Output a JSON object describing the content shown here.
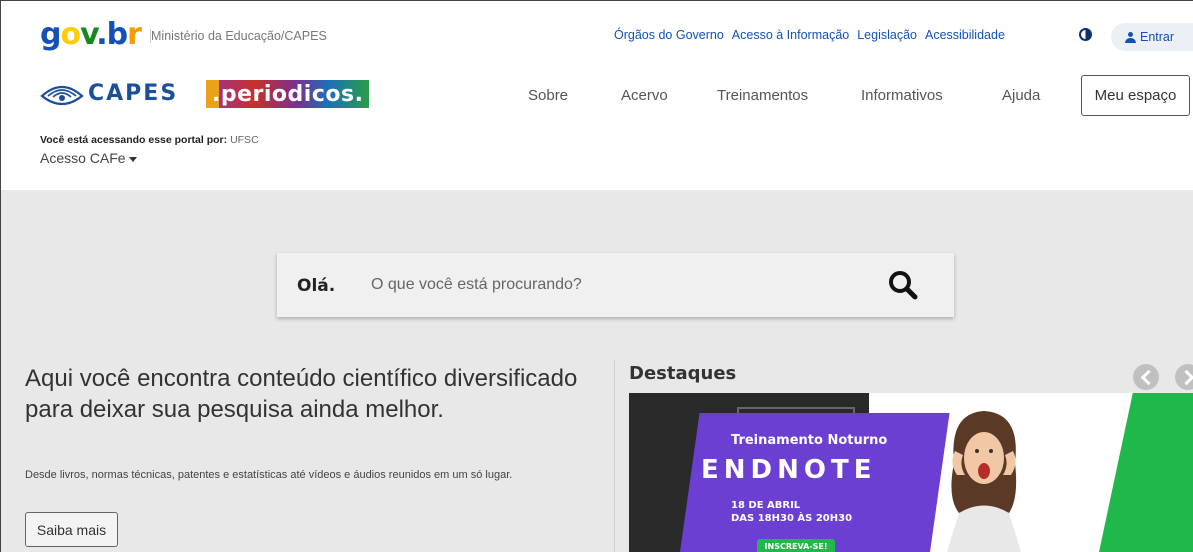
{
  "govbar": {
    "logo": {
      "g": "g",
      "o": "o",
      "v": "v",
      "dot": ".",
      "b": "b",
      "r": "r"
    },
    "ministry": "Ministério da Educação/CAPES",
    "links": [
      "Órgãos do Governo",
      "Acesso à Informação",
      "Legislação",
      "Acessibilidade"
    ],
    "contrast_icon": "contrast-icon",
    "login_label": "Entrar"
  },
  "header": {
    "capes_wordmark": "CAPES",
    "periodicos_wordmark": ".periodicos.",
    "nav": [
      "Sobre",
      "Acervo",
      "Treinamentos",
      "Informativos",
      "Ajuda"
    ],
    "meu_espaco": "Meu espaço"
  },
  "access": {
    "label": "Você está acessando esse portal por:",
    "institution": "UFSC",
    "cafe": "Acesso CAFe"
  },
  "search": {
    "hello": "Olá.",
    "placeholder": "O que você está procurando?"
  },
  "hero": {
    "title": "Aqui você encontra conteúdo científico diversificado para deixar sua pesquisa ainda melhor.",
    "description": "Desde livros, normas técnicas, patentes e estatísticas até vídeos e áudios reunidos em um só lugar.",
    "button": "Saiba mais"
  },
  "highlights": {
    "title": "Destaques",
    "banner": {
      "kicker": "Treinamento Noturno",
      "title": "ENDNOTE",
      "date_line1": "18 DE ABRIL",
      "date_line2": "DAS 18H30 ÀS 20H30",
      "cta": "INSCREVA-SE!"
    }
  },
  "colors": {
    "gov_blue": "#1351b4",
    "capes_blue": "#1b4f9c",
    "background_gray": "#e8e8e8",
    "banner_purple": "#6b3fd1",
    "banner_green": "#20b84a"
  }
}
